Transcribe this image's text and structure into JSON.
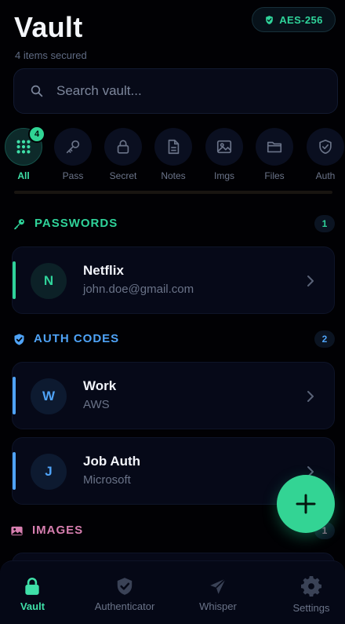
{
  "header": {
    "title": "Vault",
    "subtitle": "4 items secured",
    "encryption_badge": "AES-256"
  },
  "search": {
    "placeholder": "Search vault..."
  },
  "filters": [
    {
      "label": "All",
      "icon": "grid-icon",
      "active": true,
      "count": "4"
    },
    {
      "label": "Pass",
      "icon": "key-icon"
    },
    {
      "label": "Secret",
      "icon": "lock-icon"
    },
    {
      "label": "Notes",
      "icon": "document-icon"
    },
    {
      "label": "Imgs",
      "icon": "image-icon"
    },
    {
      "label": "Files",
      "icon": "folder-icon"
    },
    {
      "label": "Auth",
      "icon": "shield-icon"
    }
  ],
  "sections": {
    "passwords": {
      "title": "PASSWORDS",
      "count": "1",
      "color": "#2fd39a"
    },
    "auth_codes": {
      "title": "AUTH CODES",
      "count": "2",
      "color": "#4fa3f7"
    },
    "images": {
      "title": "IMAGES",
      "count": "1",
      "color": "#d77fb0"
    }
  },
  "items": {
    "netflix": {
      "initial": "N",
      "name": "Netflix",
      "subtitle": "john.doe@gmail.com"
    },
    "work": {
      "initial": "W",
      "name": "Work",
      "subtitle": "AWS"
    },
    "job_auth": {
      "initial": "J",
      "name": "Job Auth",
      "subtitle": "Microsoft"
    }
  },
  "bottom_nav": [
    {
      "label": "Vault",
      "icon": "lock-icon",
      "active": true
    },
    {
      "label": "Authenticator",
      "icon": "shield-check-icon"
    },
    {
      "label": "Whisper",
      "icon": "paper-plane-icon"
    },
    {
      "label": "Settings",
      "icon": "gear-icon"
    }
  ],
  "colors": {
    "accent": "#33d494",
    "background": "#010104",
    "auth_accent": "#4fa3f7",
    "images_accent": "#d77fb0"
  }
}
